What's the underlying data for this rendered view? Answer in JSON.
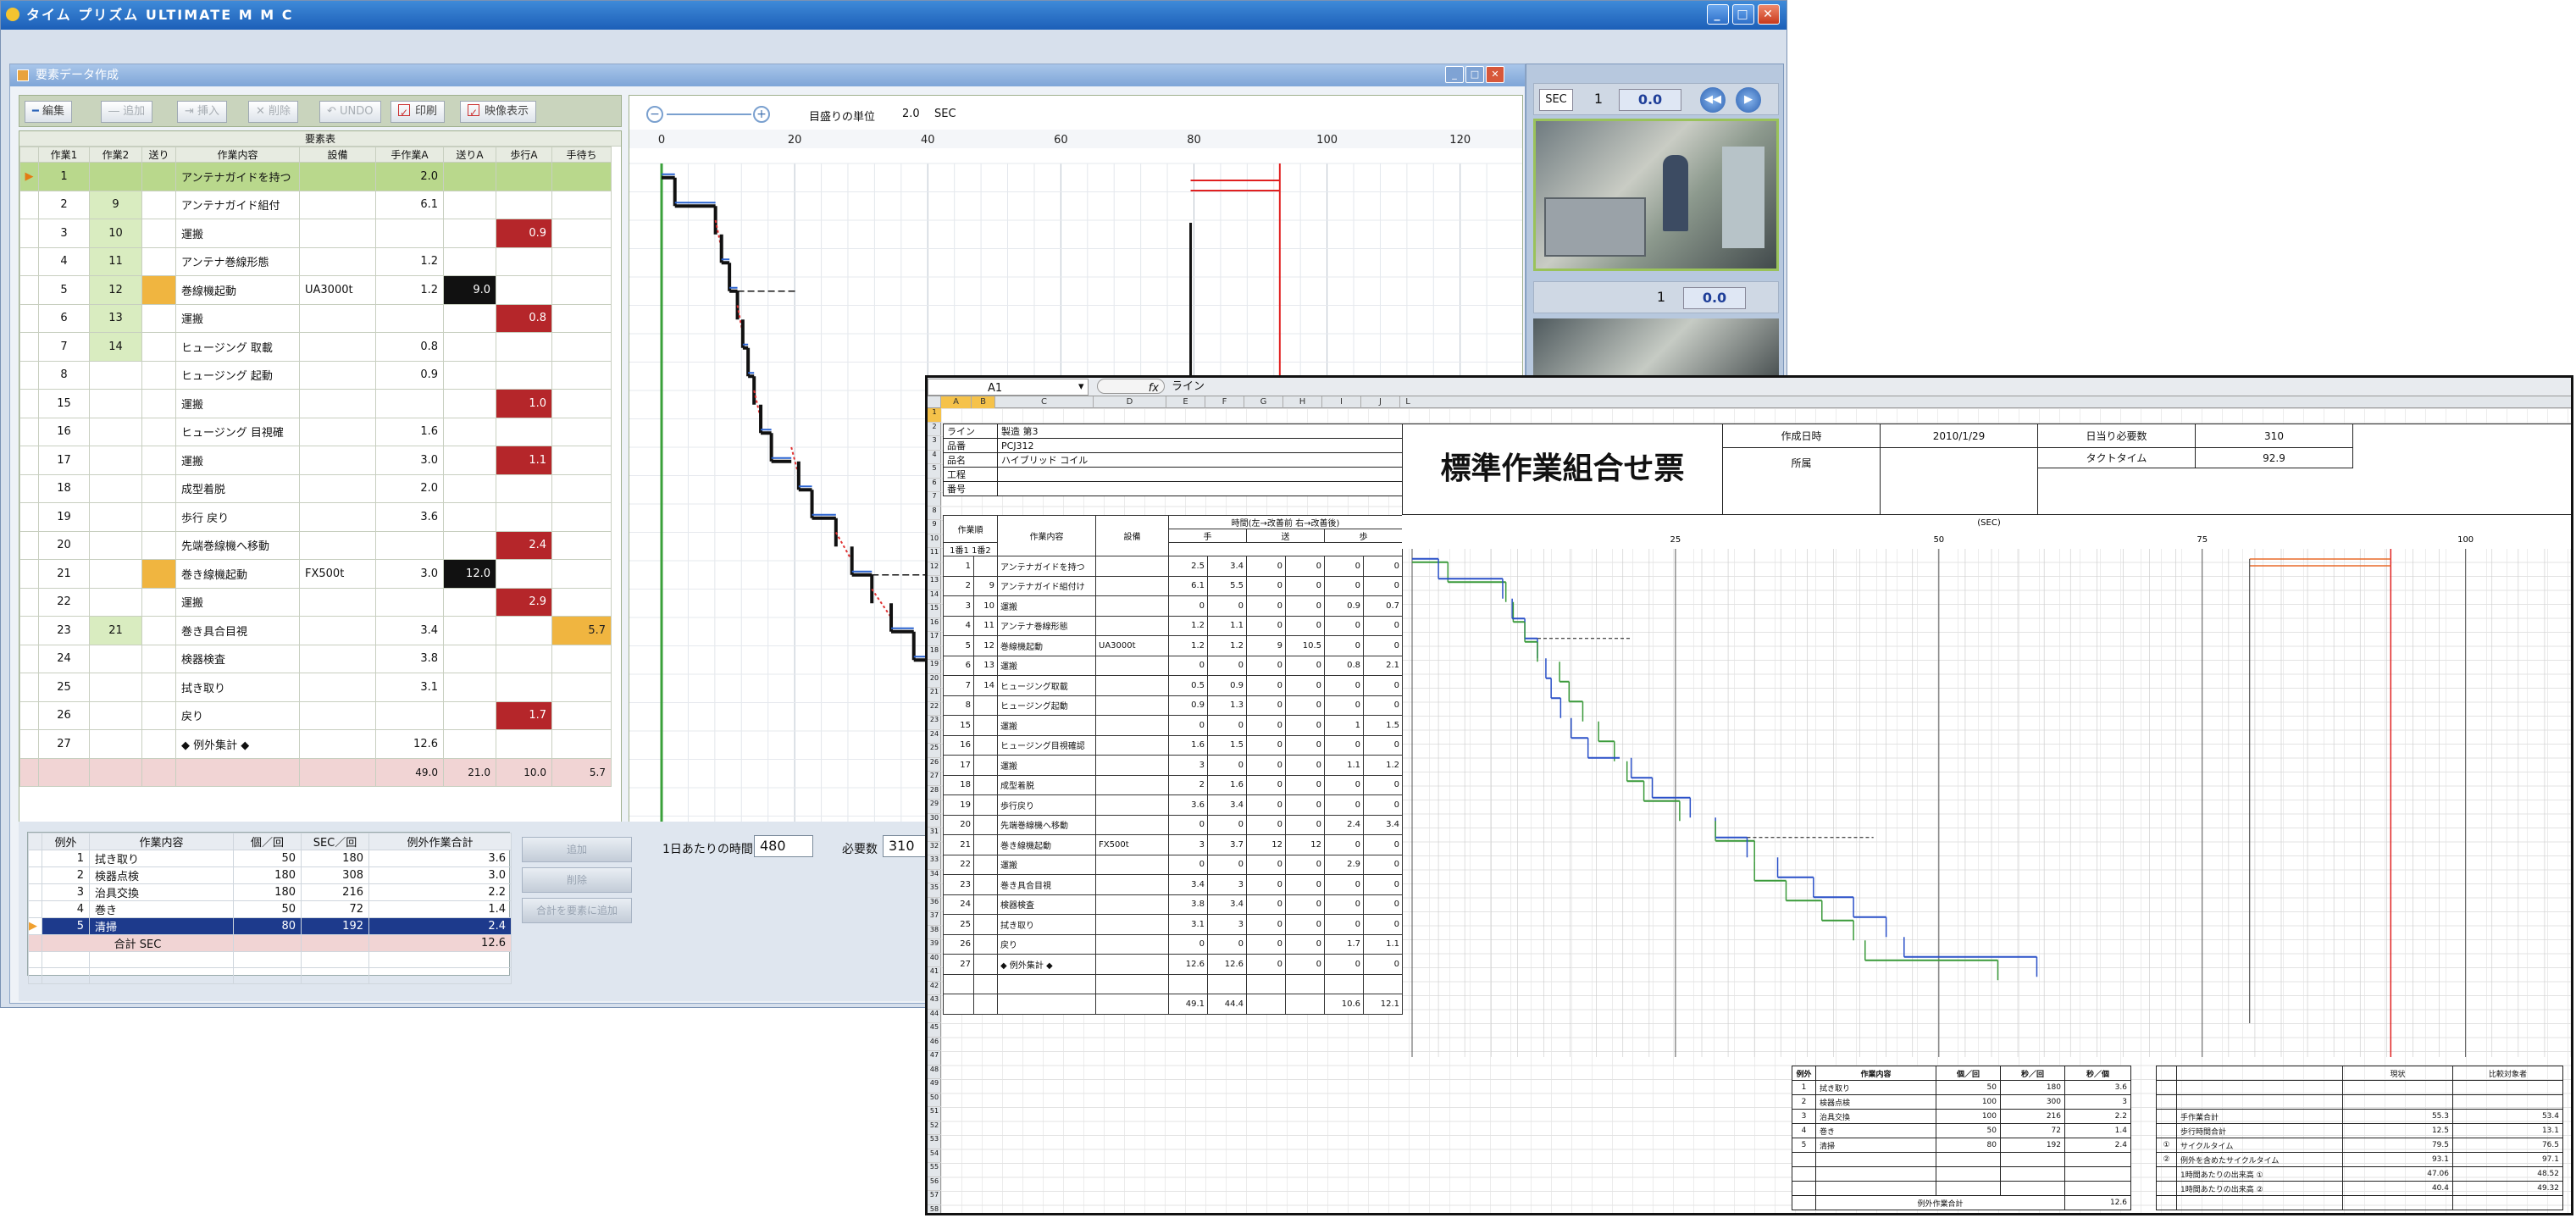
{
  "app": {
    "title": "タイム プリズム ULTIMATE M M C",
    "win_buttons": [
      "_",
      "□",
      "✕"
    ]
  },
  "subwindow": {
    "title": "要素データ作成",
    "toolbar": {
      "edit": "編集",
      "add": "追加",
      "insert": "挿入",
      "delete": "削除",
      "undo": "UNDO",
      "print": "印刷",
      "video_show": "映像表示"
    },
    "grid": {
      "super_header": "要素表",
      "headers": [
        "作業1",
        "作業2",
        "送り",
        "作業内容",
        "設備",
        "手作業A",
        "送りA",
        "歩行A",
        "手待ち"
      ],
      "rows": [
        {
          "n1": "1",
          "n2": "",
          "desc": "アンテナガイドを持つ",
          "equip": "",
          "hand": "2.0",
          "feed": "",
          "walk": "",
          "wait": ""
        },
        {
          "n1": "2",
          "n2": "9",
          "desc": "アンテナガイド組付",
          "equip": "",
          "hand": "6.1",
          "feed": "",
          "walk": "",
          "wait": ""
        },
        {
          "n1": "3",
          "n2": "10",
          "desc": "運搬",
          "equip": "",
          "hand": "",
          "feed": "",
          "walk": "0.9",
          "wait": ""
        },
        {
          "n1": "4",
          "n2": "11",
          "desc": "アンテナ巻線形態",
          "equip": "",
          "hand": "1.2",
          "feed": "",
          "walk": "",
          "wait": ""
        },
        {
          "n1": "5",
          "n2": "12",
          "desc": "巻線機起動",
          "equip": "UA3000t",
          "hand": "1.2",
          "feed": "9.0",
          "walk": "",
          "wait": ""
        },
        {
          "n1": "6",
          "n2": "13",
          "desc": "運搬",
          "equip": "",
          "hand": "",
          "feed": "",
          "walk": "0.8",
          "wait": ""
        },
        {
          "n1": "7",
          "n2": "14",
          "desc": "ヒュージング 取載",
          "equip": "",
          "hand": "0.8",
          "feed": "",
          "walk": "",
          "wait": ""
        },
        {
          "n1": "8",
          "n2": "",
          "desc": "ヒュージング 起動",
          "equip": "",
          "hand": "0.9",
          "feed": "",
          "walk": "",
          "wait": ""
        },
        {
          "n1": "15",
          "n2": "",
          "desc": "運搬",
          "equip": "",
          "hand": "",
          "feed": "",
          "walk": "1.0",
          "wait": ""
        },
        {
          "n1": "16",
          "n2": "",
          "desc": "ヒュージング 目視確",
          "equip": "",
          "hand": "1.6",
          "feed": "",
          "walk": "",
          "wait": ""
        },
        {
          "n1": "17",
          "n2": "",
          "desc": "運搬",
          "equip": "",
          "hand": "3.0",
          "feed": "",
          "walk": "1.1",
          "wait": ""
        },
        {
          "n1": "18",
          "n2": "",
          "desc": "成型着脱",
          "equip": "",
          "hand": "2.0",
          "feed": "",
          "walk": "",
          "wait": ""
        },
        {
          "n1": "19",
          "n2": "",
          "desc": "歩行 戻り",
          "equip": "",
          "hand": "3.6",
          "feed": "",
          "walk": "",
          "wait": ""
        },
        {
          "n1": "20",
          "n2": "",
          "desc": "先端巻線機へ移動",
          "equip": "",
          "hand": "",
          "feed": "",
          "walk": "2.4",
          "wait": ""
        },
        {
          "n1": "21",
          "n2": "",
          "desc": "巻き線機起動",
          "equip": "FX500t",
          "hand": "3.0",
          "feed": "12.0",
          "walk": "",
          "wait": ""
        },
        {
          "n1": "22",
          "n2": "",
          "desc": "運搬",
          "equip": "",
          "hand": "",
          "feed": "",
          "walk": "2.9",
          "wait": ""
        },
        {
          "n1": "23",
          "n2": "21",
          "desc": "巻き具合目視",
          "equip": "",
          "hand": "3.4",
          "feed": "",
          "walk": "",
          "wait": "5.7"
        },
        {
          "n1": "24",
          "n2": "",
          "desc": "検器検査",
          "equip": "",
          "hand": "3.8",
          "feed": "",
          "walk": "",
          "wait": ""
        },
        {
          "n1": "25",
          "n2": "",
          "desc": "拭き取り",
          "equip": "",
          "hand": "3.1",
          "feed": "",
          "walk": "",
          "wait": ""
        },
        {
          "n1": "26",
          "n2": "",
          "desc": "戻り",
          "equip": "",
          "hand": "",
          "feed": "",
          "walk": "1.7",
          "wait": ""
        },
        {
          "n1": "27",
          "n2": "",
          "desc": "◆ 例外集計 ◆",
          "equip": "",
          "hand": "12.6",
          "feed": "",
          "walk": "",
          "wait": ""
        }
      ],
      "totals": {
        "hand": "49.0",
        "feed": "21.0",
        "walk": "10.0",
        "wait": "5.7"
      }
    },
    "chart": {
      "scale_label": "目盛りの単位",
      "scale_value": "2.0",
      "scale_unit": "SEC",
      "ticks": [
        "0",
        "20",
        "40",
        "60",
        "80",
        "100",
        "120"
      ]
    },
    "lower": {
      "headers": [
        "例外",
        "作業内容",
        "個／回",
        "SEC／回",
        "例外作業合計"
      ],
      "rows": [
        {
          "n": "1",
          "desc": "拭き取り",
          "qty": "50",
          "sec": "180",
          "total": "3.6"
        },
        {
          "n": "2",
          "desc": "検器点検",
          "qty": "180",
          "sec": "308",
          "total": "3.0"
        },
        {
          "n": "3",
          "desc": "治具交換",
          "qty": "180",
          "sec": "216",
          "total": "2.2"
        },
        {
          "n": "4",
          "desc": "巻き",
          "qty": "50",
          "sec": "72",
          "total": "1.4"
        },
        {
          "n": "5",
          "desc": "清掃",
          "qty": "80",
          "sec": "192",
          "total": "2.4"
        }
      ],
      "sum_label": "合計 SEC",
      "sum_value": "12.6",
      "buttons": [
        "追加",
        "削除",
        "合計を要素に追加"
      ],
      "daily_label": "1日あたりの時間",
      "daily_value": "480",
      "required_label": "必要数",
      "required_value": "310"
    }
  },
  "video": {
    "unit": "SEC",
    "counter1": "1",
    "time1": "0.0",
    "counter2": "1",
    "time2": "0.0"
  },
  "excel": {
    "cell_ref": "A1",
    "fx": "fx",
    "formula": "ライン",
    "col_letters": [
      "A",
      "B",
      "C",
      "D",
      "E",
      "F",
      "G",
      "H",
      "I",
      "J",
      "K",
      "L"
    ],
    "header_labels": {
      "line": "ライン",
      "line_v": "製造 第3",
      "part": "品番",
      "part_v": "PCJ312",
      "name": "品名",
      "name_v": "ハイブリッド コイル",
      "process": "工程",
      "number": "番号"
    },
    "sheet_title": "標準作業組合せ票",
    "meta": {
      "date_label": "作成日時",
      "date": "2010/1/29",
      "day_qty_label": "日当り必要数",
      "day_qty": "310",
      "tact_label": "タクトタイム",
      "tact": "92.9",
      "dept_label": "所属"
    },
    "chart_top": {
      "unit": "(SEC)",
      "ticks": [
        "25",
        "50",
        "75",
        "100"
      ]
    },
    "table_headers": {
      "order": "作業順",
      "seq": "1番1 1番2",
      "work": "作業内容",
      "equip": "設備",
      "time": "時間(左→改善前 右→改善後)",
      "hand": "手",
      "feed": "送",
      "walk": "歩"
    },
    "rows": [
      {
        "a": "1",
        "b": "",
        "d": "アンテナガイドを持つ",
        "e": "",
        "g": "2.5",
        "h": "3.4",
        "i": "0",
        "j": "0",
        "k": "0",
        "l": "0"
      },
      {
        "a": "2",
        "b": "9",
        "d": "アンテナガイド組付け",
        "e": "",
        "g": "6.1",
        "h": "5.5",
        "i": "0",
        "j": "0",
        "k": "0",
        "l": "0"
      },
      {
        "a": "3",
        "b": "10",
        "d": "運搬",
        "e": "",
        "g": "0",
        "h": "0",
        "i": "0",
        "j": "0",
        "k": "0.9",
        "l": "0.7"
      },
      {
        "a": "4",
        "b": "11",
        "d": "アンテナ巻線形態",
        "e": "",
        "g": "1.2",
        "h": "1.1",
        "i": "0",
        "j": "0",
        "k": "0",
        "l": "0"
      },
      {
        "a": "5",
        "b": "12",
        "d": "巻線機起動",
        "e": "UA3000t",
        "g": "1.2",
        "h": "1.2",
        "i": "9",
        "j": "10.5",
        "k": "0",
        "l": "0"
      },
      {
        "a": "6",
        "b": "13",
        "d": "運搬",
        "e": "",
        "g": "0",
        "h": "0",
        "i": "0",
        "j": "0",
        "k": "0.8",
        "l": "2.1"
      },
      {
        "a": "7",
        "b": "14",
        "d": "ヒュージング取載",
        "e": "",
        "g": "0.5",
        "h": "0.9",
        "i": "0",
        "j": "0",
        "k": "0",
        "l": "0"
      },
      {
        "a": "8",
        "b": "",
        "d": "ヒュージング起動",
        "e": "",
        "g": "0.9",
        "h": "1.3",
        "i": "0",
        "j": "0",
        "k": "0",
        "l": "0"
      },
      {
        "a": "15",
        "b": "",
        "d": "運搬",
        "e": "",
        "g": "0",
        "h": "0",
        "i": "0",
        "j": "0",
        "k": "1",
        "l": "1.5"
      },
      {
        "a": "16",
        "b": "",
        "d": "ヒュージング目視確認",
        "e": "",
        "g": "1.6",
        "h": "1.5",
        "i": "0",
        "j": "0",
        "k": "0",
        "l": "0"
      },
      {
        "a": "17",
        "b": "",
        "d": "運搬",
        "e": "",
        "g": "3",
        "h": "0",
        "i": "0",
        "j": "0",
        "k": "1.1",
        "l": "1.2"
      },
      {
        "a": "18",
        "b": "",
        "d": "成型着脱",
        "e": "",
        "g": "2",
        "h": "1.6",
        "i": "0",
        "j": "0",
        "k": "0",
        "l": "0"
      },
      {
        "a": "19",
        "b": "",
        "d": "歩行戻り",
        "e": "",
        "g": "3.6",
        "h": "3.4",
        "i": "0",
        "j": "0",
        "k": "0",
        "l": "0"
      },
      {
        "a": "20",
        "b": "",
        "d": "先端巻線機へ移動",
        "e": "",
        "g": "0",
        "h": "0",
        "i": "0",
        "j": "0",
        "k": "2.4",
        "l": "3.4"
      },
      {
        "a": "21",
        "b": "",
        "d": "巻き線機起動",
        "e": "FX500t",
        "g": "3",
        "h": "3.7",
        "i": "12",
        "j": "12",
        "k": "0",
        "l": "0"
      },
      {
        "a": "22",
        "b": "",
        "d": "運搬",
        "e": "",
        "g": "0",
        "h": "0",
        "i": "0",
        "j": "0",
        "k": "2.9",
        "l": "0"
      },
      {
        "a": "23",
        "b": "",
        "d": "巻き具合目視",
        "e": "",
        "g": "3.4",
        "h": "3",
        "i": "0",
        "j": "0",
        "k": "0",
        "l": "0"
      },
      {
        "a": "24",
        "b": "",
        "d": "検器検査",
        "e": "",
        "g": "3.8",
        "h": "3.4",
        "i": "0",
        "j": "0",
        "k": "0",
        "l": "0"
      },
      {
        "a": "25",
        "b": "",
        "d": "拭き取り",
        "e": "",
        "g": "3.1",
        "h": "3",
        "i": "0",
        "j": "0",
        "k": "0",
        "l": "0"
      },
      {
        "a": "26",
        "b": "",
        "d": "戻り",
        "e": "",
        "g": "0",
        "h": "0",
        "i": "0",
        "j": "0",
        "k": "1.7",
        "l": "1.1"
      },
      {
        "a": "27",
        "b": "",
        "d": "◆ 例外集計 ◆",
        "e": "",
        "g": "12.6",
        "h": "12.6",
        "i": "0",
        "j": "0",
        "k": "0",
        "l": "0"
      }
    ],
    "sum_row": {
      "g": "49.1",
      "h": "44.4",
      "k": "10.6",
      "l": "12.1"
    },
    "exc": {
      "headers": [
        "例外",
        "作業内容",
        "個／回",
        "秒／回",
        "秒／個"
      ],
      "rows": [
        {
          "n": "1",
          "d": "拭き取り",
          "q": "50",
          "s": "180",
          "t": "3.6"
        },
        {
          "n": "2",
          "d": "検器点検",
          "q": "100",
          "s": "300",
          "t": "3"
        },
        {
          "n": "3",
          "d": "治具交換",
          "q": "100",
          "s": "216",
          "t": "2.2"
        },
        {
          "n": "4",
          "d": "巻き",
          "q": "50",
          "s": "72",
          "t": "1.4"
        },
        {
          "n": "5",
          "d": "清掃",
          "q": "80",
          "s": "192",
          "t": "2.4"
        }
      ],
      "total_label": "例外作業合計",
      "total_value": "12.6"
    },
    "summary": {
      "h1": "現状",
      "h2": "比較対象者",
      "rows": [
        {
          "mark": "",
          "label": "手作業合計",
          "v1": "55.3",
          "v2": "53.4"
        },
        {
          "mark": "",
          "label": "歩行時間合計",
          "v1": "12.5",
          "v2": "13.1"
        },
        {
          "mark": "①",
          "label": "サイクルタイム",
          "v1": "79.5",
          "v2": "76.5"
        },
        {
          "mark": "②",
          "label": "例外を含めたサイクルタイム",
          "v1": "93.1",
          "v2": "97.1"
        },
        {
          "mark": "",
          "label": "1時間あたりの出来高 ①",
          "v1": "47.06",
          "v2": "48.52"
        },
        {
          "mark": "",
          "label": "1時間あたりの出来高 ②",
          "v1": "40.4",
          "v2": "49.32"
        }
      ]
    }
  }
}
